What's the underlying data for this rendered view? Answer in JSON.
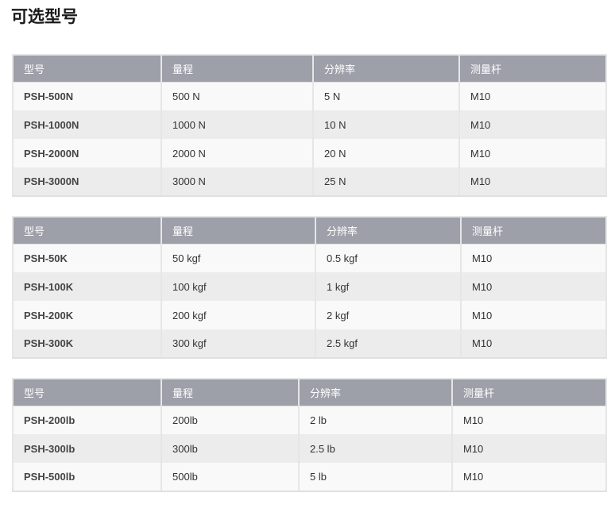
{
  "page_title": "可选型号",
  "tables": [
    {
      "headers": [
        "型号",
        "量程",
        "分辨率",
        "测量杆"
      ],
      "rows": [
        [
          "PSH-500N",
          "500 N",
          "5 N",
          "M10"
        ],
        [
          "PSH-1000N",
          "1000 N",
          "10 N",
          "M10"
        ],
        [
          "PSH-2000N",
          "2000 N",
          "20 N",
          "M10"
        ],
        [
          "PSH-3000N",
          "3000 N",
          "25 N",
          "M10"
        ]
      ]
    },
    {
      "headers": [
        "型号",
        "量程",
        "分辨率",
        "测量杆"
      ],
      "rows": [
        [
          "PSH-50K",
          "50 kgf",
          "0.5 kgf",
          "M10"
        ],
        [
          "PSH-100K",
          "100 kgf",
          "1 kgf",
          "M10"
        ],
        [
          "PSH-200K",
          "200 kgf",
          "2 kgf",
          "M10"
        ],
        [
          "PSH-300K",
          "300 kgf",
          "2.5 kgf",
          "M10"
        ]
      ]
    },
    {
      "headers": [
        "型号",
        "量程",
        "分辨率",
        "测量杆"
      ],
      "rows": [
        [
          "PSH-200lb",
          "200lb",
          "2 lb",
          "M10"
        ],
        [
          "PSH-300lb",
          "300lb",
          "2.5 lb",
          "M10"
        ],
        [
          "PSH-500lb",
          "500lb",
          "5 lb",
          "M10"
        ]
      ]
    }
  ]
}
